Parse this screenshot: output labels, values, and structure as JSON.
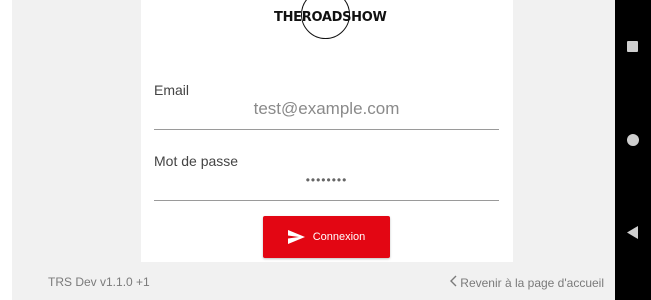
{
  "app": {
    "logo_text": "THEROADSHOW"
  },
  "login_form": {
    "email_label": "Email",
    "email_value": "test@example.com",
    "password_label": "Mot de passe",
    "password_value": "••••••••",
    "submit_label": "Connexion",
    "submit_icon": "send-icon"
  },
  "footer": {
    "version": "TRS Dev v1.1.0 +1",
    "back_link": "Revenir à la page d'accueil",
    "back_icon": "chevron-left-icon"
  },
  "system_nav": {
    "recents_icon": "square-icon",
    "home_icon": "circle-icon",
    "back_icon": "triangle-back-icon"
  },
  "colors": {
    "accent": "#e30613",
    "background": "#f1f1f1",
    "card": "#ffffff"
  }
}
